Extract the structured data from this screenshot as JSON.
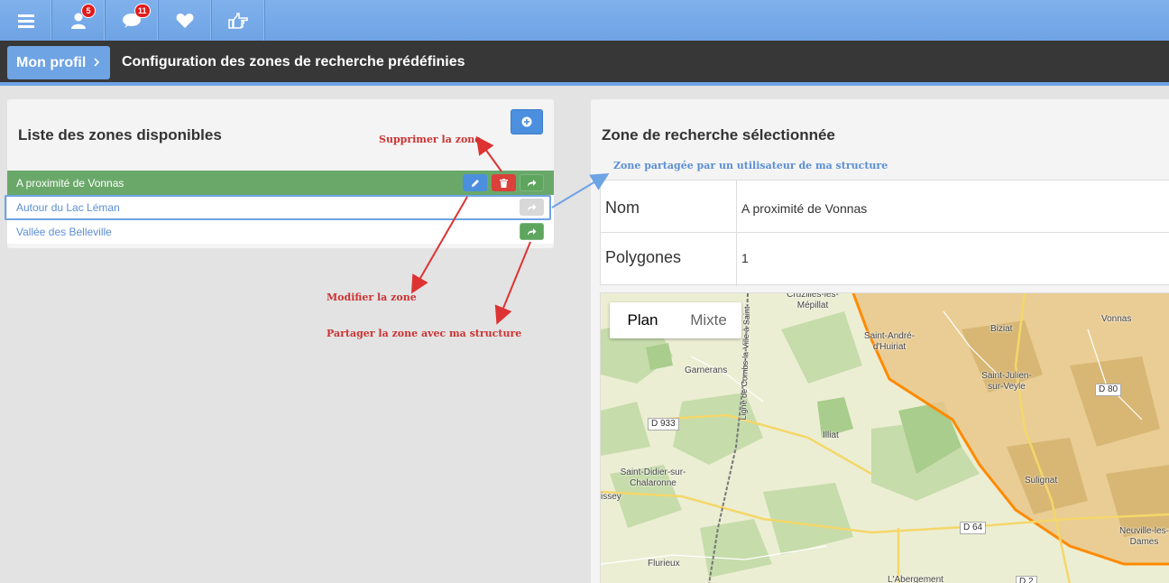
{
  "topbar": {
    "menu_icon": "hamburger-icon",
    "users_badge": "5",
    "messages_badge": "11",
    "icons": [
      "hamburger-icon",
      "user-icon",
      "chat-icon",
      "heart-icon",
      "thumb-point-icon"
    ]
  },
  "breadcrumb": {
    "root": "Mon profil",
    "title": "Configuration des zones de recherche prédéfinies"
  },
  "zones_panel": {
    "title": "Liste des zones disponibles",
    "items": [
      {
        "label": "A proximité de Vonnas"
      },
      {
        "label": "Autour du Lac Léman"
      },
      {
        "label": "Vallée des Belleville"
      }
    ]
  },
  "annotations": {
    "delete": "Supprimer la zone",
    "edit": "Modifier la zone",
    "share": "Partager la zone avec ma structure",
    "shared": "Zone partagée par un utilisateur de ma structure"
  },
  "selected_zone": {
    "title": "Zone de recherche sélectionnée",
    "rows": [
      {
        "key": "Nom",
        "value": "A proximité de Vonnas"
      },
      {
        "key": "Polygones",
        "value": "1"
      }
    ]
  },
  "map": {
    "toggle": {
      "plan": "Plan",
      "mixte": "Mixte"
    },
    "places": [
      "Cruzilles-lès-Mépillat",
      "Saint-André-d'Huiriat",
      "Biziat",
      "Vonnas",
      "Saint-Julien-sur-Veyle",
      "Garnerans",
      "Illiat",
      "Saint-Didier-sur-Chalaronne",
      "issey",
      "Sulignat",
      "Neuville-les-Dames",
      "Flurieux",
      "L'Abergement"
    ],
    "roads": [
      "D 933",
      "D 80",
      "D 64",
      "D 2"
    ],
    "rail_label": "Ligne de Combs-la-Ville à Saint-",
    "colors": {
      "polygon_stroke": "#ff8a00",
      "land": "#eef0d8",
      "forest": "#bcd8a4"
    }
  }
}
